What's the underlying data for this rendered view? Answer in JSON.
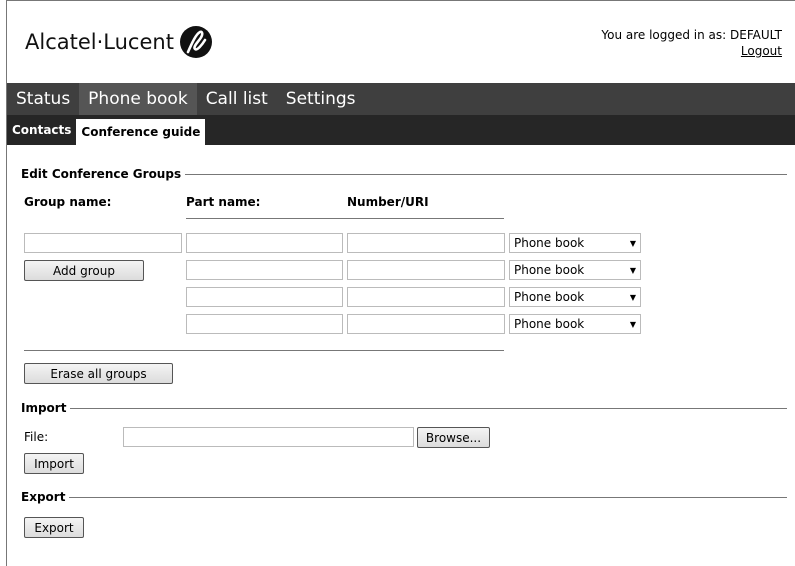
{
  "header": {
    "logo_text": "Alcatel·Lucent",
    "logged_in_text": "You are logged in as: DEFAULT",
    "logout_label": "Logout"
  },
  "main_nav": {
    "tabs": [
      {
        "label": "Status"
      },
      {
        "label": "Phone book"
      },
      {
        "label": "Call list"
      },
      {
        "label": "Settings"
      }
    ],
    "active": "Phone book"
  },
  "sub_nav": {
    "tabs": [
      {
        "label": "Contacts"
      },
      {
        "label": "Conference guide"
      }
    ],
    "active": "Conference guide"
  },
  "edit_groups": {
    "title": "Edit Conference Groups",
    "col_group_name": "Group name:",
    "col_part_name": "Part name:",
    "col_number": "Number/URI",
    "group_name_value": "",
    "add_group_label": "Add group",
    "rows": [
      {
        "part_name": "",
        "number": "",
        "source": "Phone book"
      },
      {
        "part_name": "",
        "number": "",
        "source": "Phone book"
      },
      {
        "part_name": "",
        "number": "",
        "source": "Phone book"
      },
      {
        "part_name": "",
        "number": "",
        "source": "Phone book"
      }
    ],
    "erase_all_label": "Erase all groups"
  },
  "import": {
    "title": "Import",
    "file_label": "File:",
    "file_value": "",
    "browse_label": "Browse...",
    "import_label": "Import"
  },
  "export": {
    "title": "Export",
    "export_label": "Export"
  }
}
